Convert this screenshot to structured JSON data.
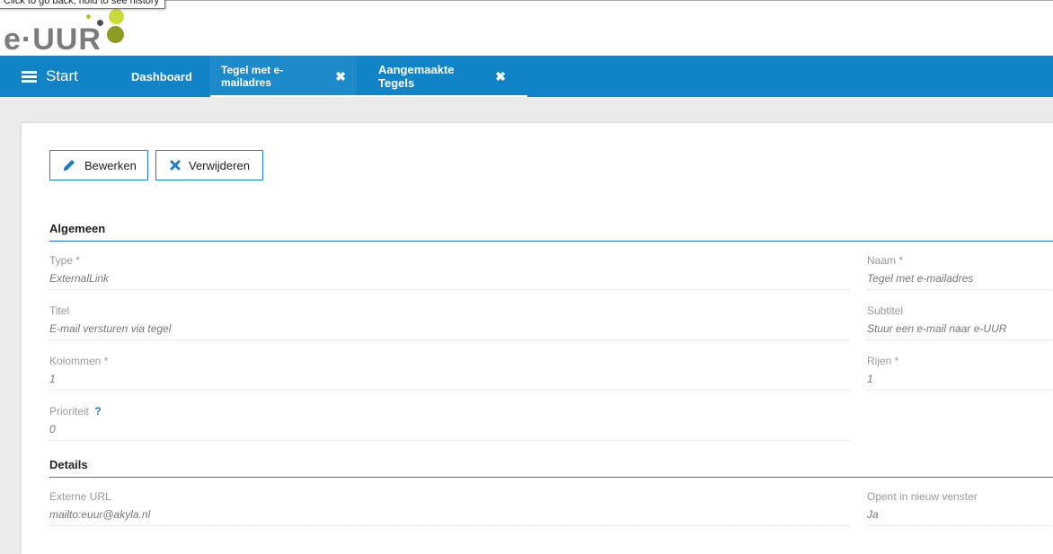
{
  "tooltip": "Click to go back, hold to see history",
  "logo": {
    "text": "e·UUR"
  },
  "nav": {
    "start_label": "Start",
    "tabs": [
      {
        "label": "Dashboard"
      },
      {
        "label": "Tegel met e-mailadres"
      },
      {
        "label": "Aangemaakte Tegels"
      }
    ]
  },
  "toolbar": {
    "edit_label": "Bewerken",
    "delete_label": "Verwijderen"
  },
  "sections": {
    "general": {
      "title": "Algemeen",
      "type_label": "Type *",
      "type_value": "ExternalLink",
      "name_label": "Naam *",
      "name_value": "Tegel met e-mailadres",
      "title_label": "Titel",
      "title_value": "E-mail versturen via tegel",
      "subtitle_label": "Subtitel",
      "subtitle_value": "Stuur een e-mail naar e-UUR",
      "columns_label": "Kolommen *",
      "columns_value": "1",
      "rows_label": "Rijen *",
      "rows_value": "1",
      "priority_label": "Prioriteit",
      "priority_help": "?",
      "priority_value": "0"
    },
    "details": {
      "title": "Details",
      "url_label": "Externe URL",
      "url_value": "mailto:euur@akyla.nl",
      "newwindow_label": "Opent in nieuw venster",
      "newwindow_value": "Ja"
    }
  },
  "colors": {
    "brand": "#1184c8",
    "accent": "#1d7fc0",
    "logo_green": "#a6bd2c"
  }
}
